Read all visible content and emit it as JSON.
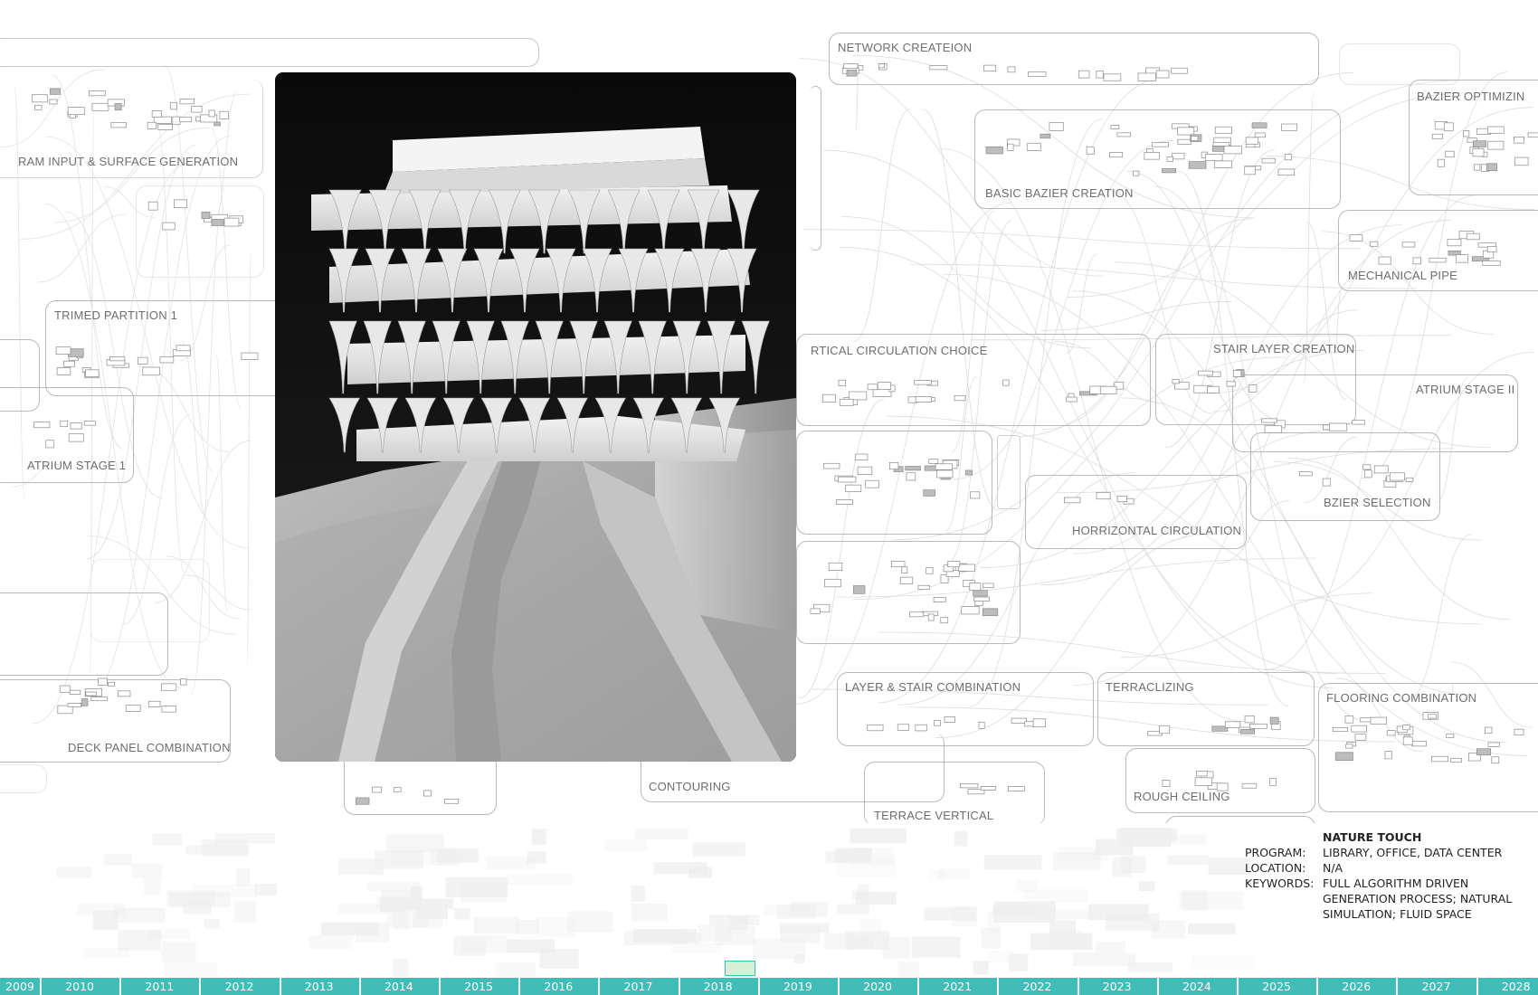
{
  "diagram": {
    "labels": {
      "program_input": "RAM INPUT & SURFACE GENERATION",
      "trimmed_partition": "TRIMED PARTITION 1",
      "atrium_stage_1": "ATRIUM STAGE 1",
      "deck_panel": "DECK PANEL COMBINATION",
      "network_creation": "NETWORK CREATEION",
      "basic_bezier": "BASIC BAZIER CREATION",
      "bezier_optimizing": "BAZIER OPTIMIZIN",
      "mechanical_pipe": "MECHANICAL PIPE",
      "vertical_circulation": "RTICAL CIRCULATION CHOICE",
      "stair_layer": "STAIR LAYER CREATION",
      "atrium_stage_2": "ATRIUM STAGE II",
      "bezier_selection": "BZIER SELECTION",
      "horizontal_circulation": "HORRIZONTAL CIRCULATION",
      "layer_stair": "LAYER & STAIR COMBINATION",
      "terraclizing": "TERRACLIZING",
      "flooring": "FLOORING COMBINATION",
      "contouring": "CONTOURING",
      "rough_ceiling": "ROUGH CEILING",
      "terrace_vertical": "TERRACE VERTICAL"
    }
  },
  "project": {
    "title": "NATURE TOUCH",
    "program_key": "PROGRAM:",
    "program_value": "LIBRARY, OFFICE, DATA CENTER",
    "location_key": "LOCATION:",
    "location_value": "N/A",
    "keywords_key": "KEYWORDS:",
    "keywords_line1": "FULL ALGORITHM DRIVEN",
    "keywords_line2": "GENERATION PROCESS; NATURAL",
    "keywords_line3": "SIMULATION; FLUID SPACE"
  },
  "timeline": {
    "years": [
      "2009",
      "2010",
      "2011",
      "2012",
      "2013",
      "2014",
      "2015",
      "2016",
      "2017",
      "2018",
      "2019",
      "2020",
      "2021",
      "2022",
      "2023",
      "2024",
      "2025",
      "2026",
      "2027",
      "2028"
    ],
    "selected_year": "2018",
    "accent": "#3fbdb6"
  },
  "photo": {
    "subject": "3D printed architectural model"
  }
}
